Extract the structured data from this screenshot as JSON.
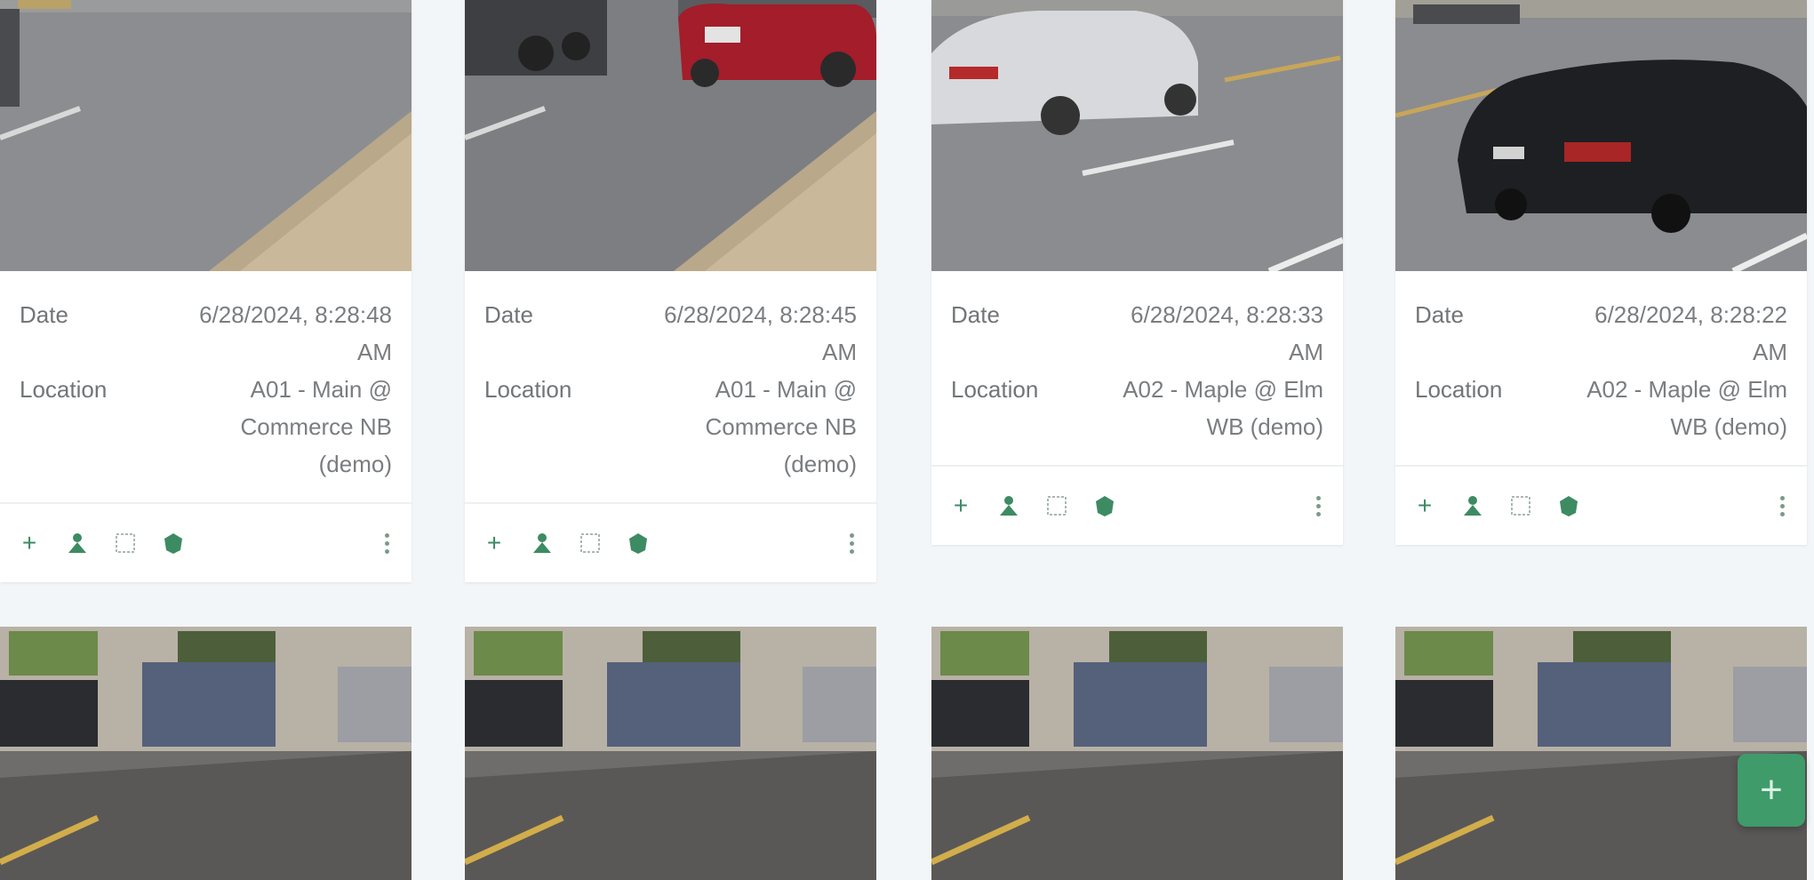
{
  "cards": [
    {
      "date_label": "Date",
      "date_value": "6/28/2024, 8:28:48 AM",
      "location_label": "Location",
      "location_value": "A01 - Main @ Commerce NB (demo)"
    },
    {
      "date_label": "Date",
      "date_value": "6/28/2024, 8:28:45 AM",
      "location_label": "Location",
      "location_value": "A01 - Main @ Commerce NB (demo)"
    },
    {
      "date_label": "Date",
      "date_value": "6/28/2024, 8:28:33 AM",
      "location_label": "Location",
      "location_value": "A02 - Maple @ Elm WB (demo)"
    },
    {
      "date_label": "Date",
      "date_value": "6/28/2024, 8:28:22 AM",
      "location_label": "Location",
      "location_value": "A02 - Maple @ Elm WB (demo)"
    }
  ],
  "actions": {
    "icons": [
      "plus-icon",
      "person-icon",
      "crop-icon",
      "shield-icon",
      "more-vertical-icon"
    ]
  },
  "fab": {
    "icon": "plus-icon"
  },
  "colors": {
    "accent": "#3f9b6a",
    "icon": "#3d8b63",
    "background": "#f3f6f8"
  }
}
